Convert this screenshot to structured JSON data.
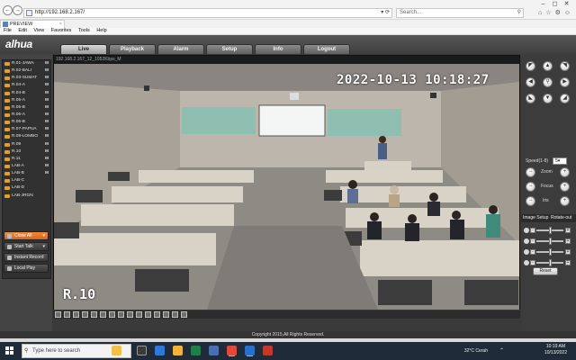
{
  "browser": {
    "url": "http://192.168.2.167/",
    "search_placeholder": "Search...",
    "tab_title": "PREVIEW",
    "menu": [
      "File",
      "Edit",
      "View",
      "Favorites",
      "Tools",
      "Help"
    ]
  },
  "app": {
    "logo_text": "alhua",
    "nav_tabs": [
      "Live",
      "Playback",
      "Alarm",
      "Setup",
      "Info",
      "Logout"
    ],
    "active_tab": "Live",
    "footer": "Copyright 2015,All Rights Reserved."
  },
  "cameras": [
    {
      "label": "R.01-JAWA",
      "flag": "M"
    },
    {
      "label": "R.02-BALI",
      "flag": "M"
    },
    {
      "label": "R.03-SUMAT",
      "flag": "M"
    },
    {
      "label": "R.04-A",
      "flag": "M"
    },
    {
      "label": "R.04-B",
      "flag": "M"
    },
    {
      "label": "R.05-A",
      "flag": "M"
    },
    {
      "label": "R.05-B",
      "flag": "M"
    },
    {
      "label": "R.06-A",
      "flag": "M"
    },
    {
      "label": "R.06-B",
      "flag": "M"
    },
    {
      "label": "R.07-PAPUA",
      "flag": "M"
    },
    {
      "label": "R.08-LOMBO",
      "flag": "M"
    },
    {
      "label": "R.09",
      "flag": "M"
    },
    {
      "label": "R.10",
      "flag": "M"
    },
    {
      "label": "R.11",
      "flag": "M"
    },
    {
      "label": "LAB-A",
      "flag": "M"
    },
    {
      "label": "LAB-B",
      "flag": "M"
    },
    {
      "label": "LAB-C",
      "flag": ""
    },
    {
      "label": "LAB-D",
      "flag": ""
    },
    {
      "label": "LAB-JRGN",
      "flag": ""
    }
  ],
  "side_buttons": {
    "close_all": "Close All",
    "start_talk": "Start Talk",
    "instant_record": "Instant Record",
    "local_play": "Local Play"
  },
  "video": {
    "stream_label": "192.168.2.167_12_1052Kbps_M",
    "timestamp": "2022-10-13 10:18:27",
    "channel_name": "R.10"
  },
  "ptz": {
    "speed_label": "Speed(1-8)",
    "speed_value": "5",
    "zoom_label": "Zoom",
    "focus_label": "Focus",
    "iris_label": "Iris",
    "image_setup_tab": "Image Setup",
    "rotate_tab": "Rotate-out",
    "sliders": [
      0.5,
      0.5,
      0.5,
      0.5
    ],
    "reset_label": "Reset"
  },
  "taskbar": {
    "search_placeholder": "Type here to search",
    "weather": "32°C Cerah",
    "time": "10:19 AM",
    "date": "10/13/2022"
  },
  "colors": {
    "accent_orange": "#e0722a",
    "header_bg": "#4a4a4a",
    "taskbar_bg": "#1f2b38"
  }
}
